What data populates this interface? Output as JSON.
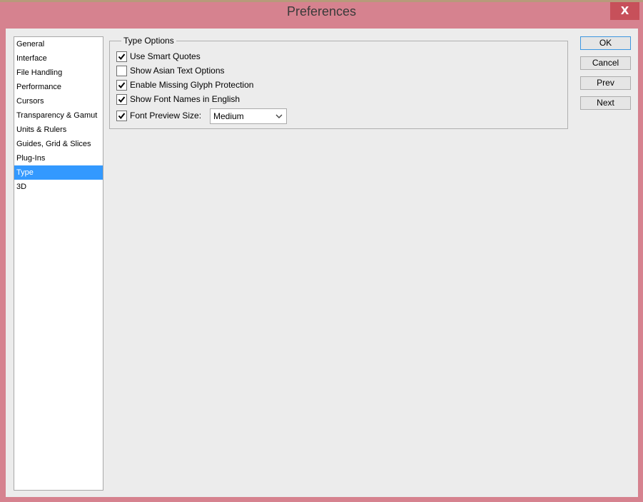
{
  "window": {
    "title": "Preferences",
    "close_label": "X"
  },
  "sidebar": {
    "items": [
      {
        "label": "General",
        "selected": false
      },
      {
        "label": "Interface",
        "selected": false
      },
      {
        "label": "File Handling",
        "selected": false
      },
      {
        "label": "Performance",
        "selected": false
      },
      {
        "label": "Cursors",
        "selected": false
      },
      {
        "label": "Transparency & Gamut",
        "selected": false
      },
      {
        "label": "Units & Rulers",
        "selected": false
      },
      {
        "label": "Guides, Grid & Slices",
        "selected": false
      },
      {
        "label": "Plug-Ins",
        "selected": false
      },
      {
        "label": "Type",
        "selected": true
      },
      {
        "label": "3D",
        "selected": false
      }
    ]
  },
  "type_options": {
    "legend": "Type Options",
    "options": [
      {
        "label": "Use Smart Quotes",
        "checked": true
      },
      {
        "label": "Show Asian Text Options",
        "checked": false
      },
      {
        "label": "Enable Missing Glyph Protection",
        "checked": true
      },
      {
        "label": "Show Font Names in English",
        "checked": true
      },
      {
        "label": "Font Preview Size:",
        "checked": true
      }
    ],
    "font_preview_size": "Medium"
  },
  "buttons": {
    "ok": "OK",
    "cancel": "Cancel",
    "prev": "Prev",
    "next": "Next"
  },
  "colors": {
    "selection": "#3399ff",
    "title_bar": "#d6828f",
    "close_button": "#c7505a"
  }
}
